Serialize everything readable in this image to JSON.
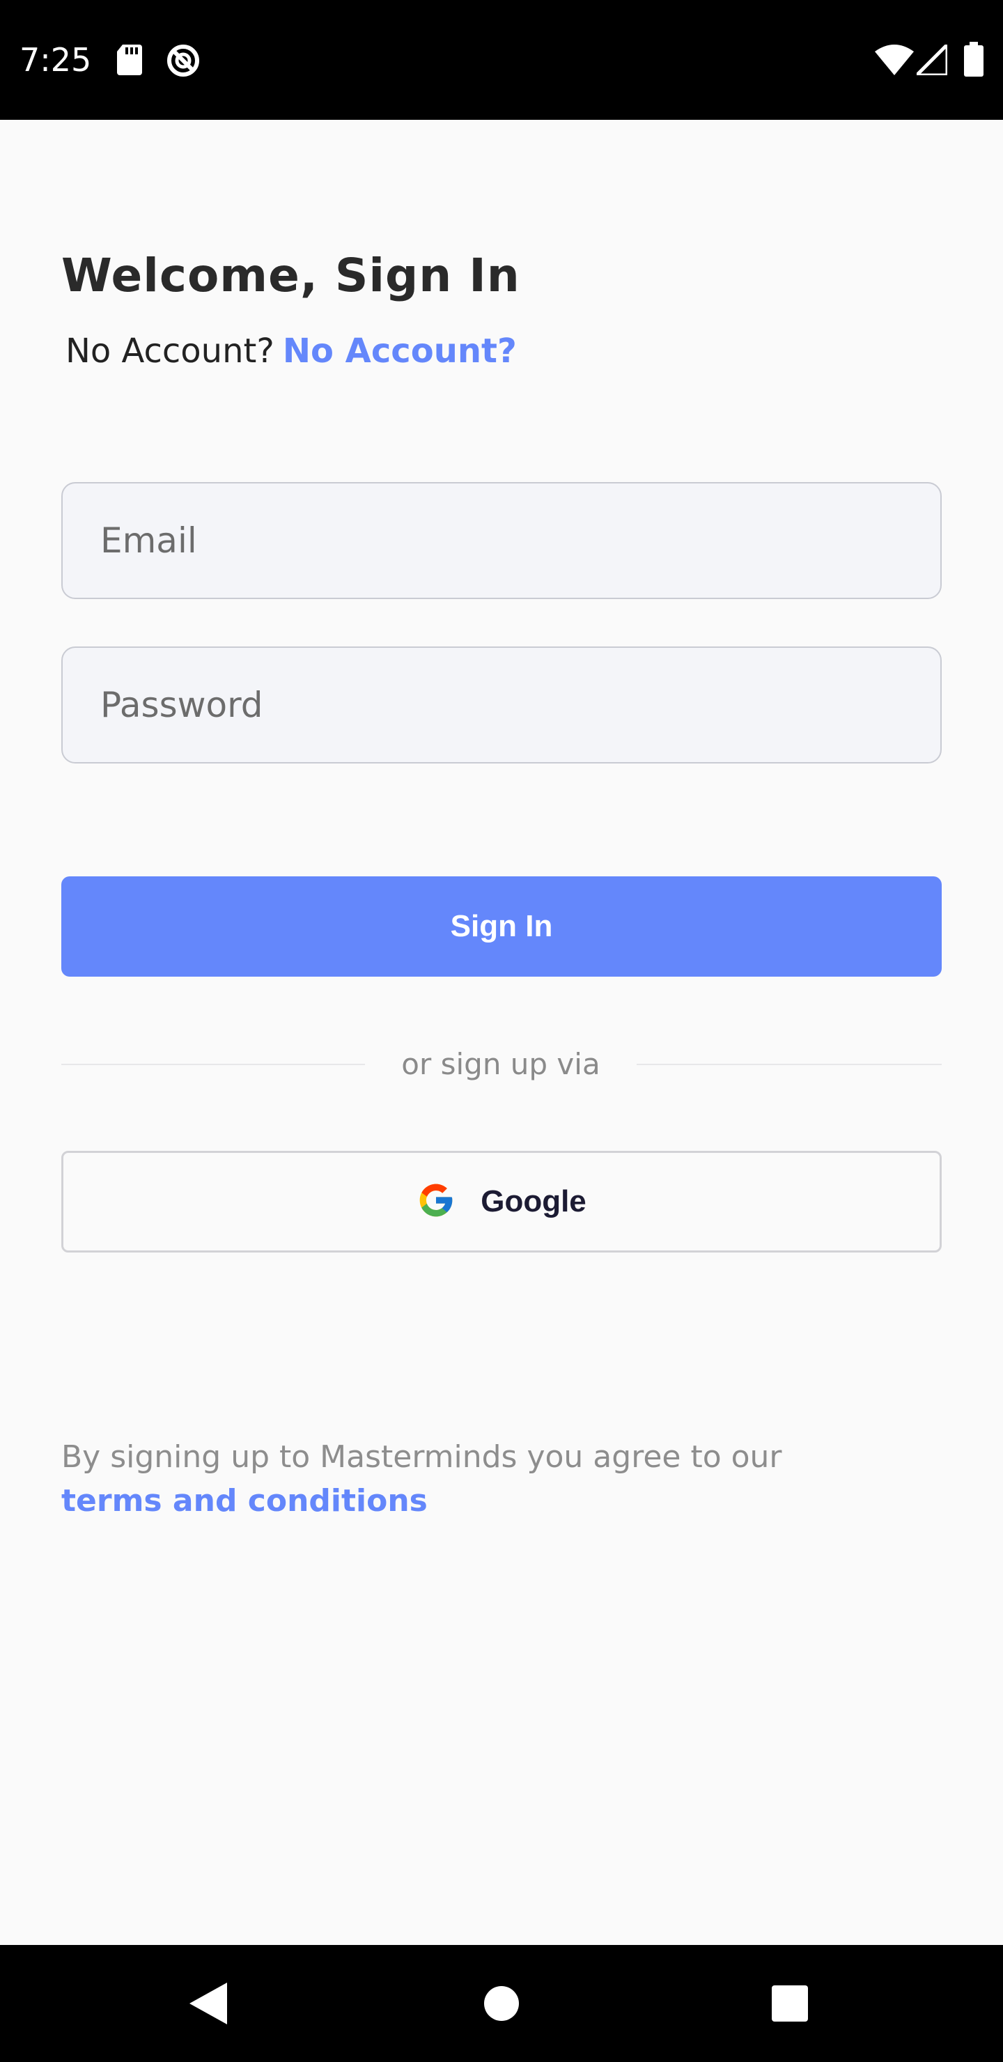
{
  "status_bar": {
    "time": "7:25",
    "icons": [
      "sd-card-icon",
      "do-not-disturb-icon",
      "wifi-icon",
      "cell-signal-icon",
      "battery-icon"
    ]
  },
  "header": {
    "title": "Welcome, Sign In",
    "prompt": "No Account?",
    "link": "No Account?"
  },
  "form": {
    "email_placeholder": "Email",
    "password_placeholder": "Password",
    "signin_label": "Sign In"
  },
  "divider": {
    "text": "or sign up via"
  },
  "social": {
    "google_label": "Google",
    "google_icon": "google-logo-icon"
  },
  "terms": {
    "text": "By signing up to Masterminds you agree to our",
    "link": "terms and conditions"
  },
  "nav_bar": {
    "icons": [
      "back-icon",
      "home-icon",
      "recents-icon"
    ]
  },
  "colors": {
    "accent": "#6487fb",
    "status_bar": "#000000",
    "background": "#fafafa",
    "input_bg": "#f4f5f9"
  }
}
